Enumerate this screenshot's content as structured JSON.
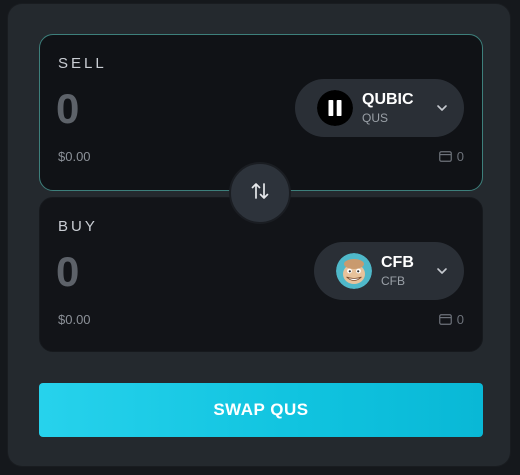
{
  "sell": {
    "label": "SELL",
    "amount_value": "",
    "amount_placeholder": "0",
    "usd_value": "$0.00",
    "balance": "0",
    "token": {
      "symbol": "QUBIC",
      "name": "QUS",
      "logo_icon": "qubic-logo-icon"
    }
  },
  "buy": {
    "label": "BUY",
    "amount_value": "",
    "amount_placeholder": "0",
    "usd_value": "$0.00",
    "balance": "0",
    "token": {
      "symbol": "CFB",
      "name": "CFB",
      "logo_icon": "cfb-avatar-icon"
    }
  },
  "switch_icon": "swap-arrows-icon",
  "swap_button_label": "SWAP QUS",
  "colors": {
    "accent": "#1ecbe6",
    "sell_border": "#3d7f7b",
    "panel_bg": "#101216",
    "frame_bg": "#24292e"
  }
}
